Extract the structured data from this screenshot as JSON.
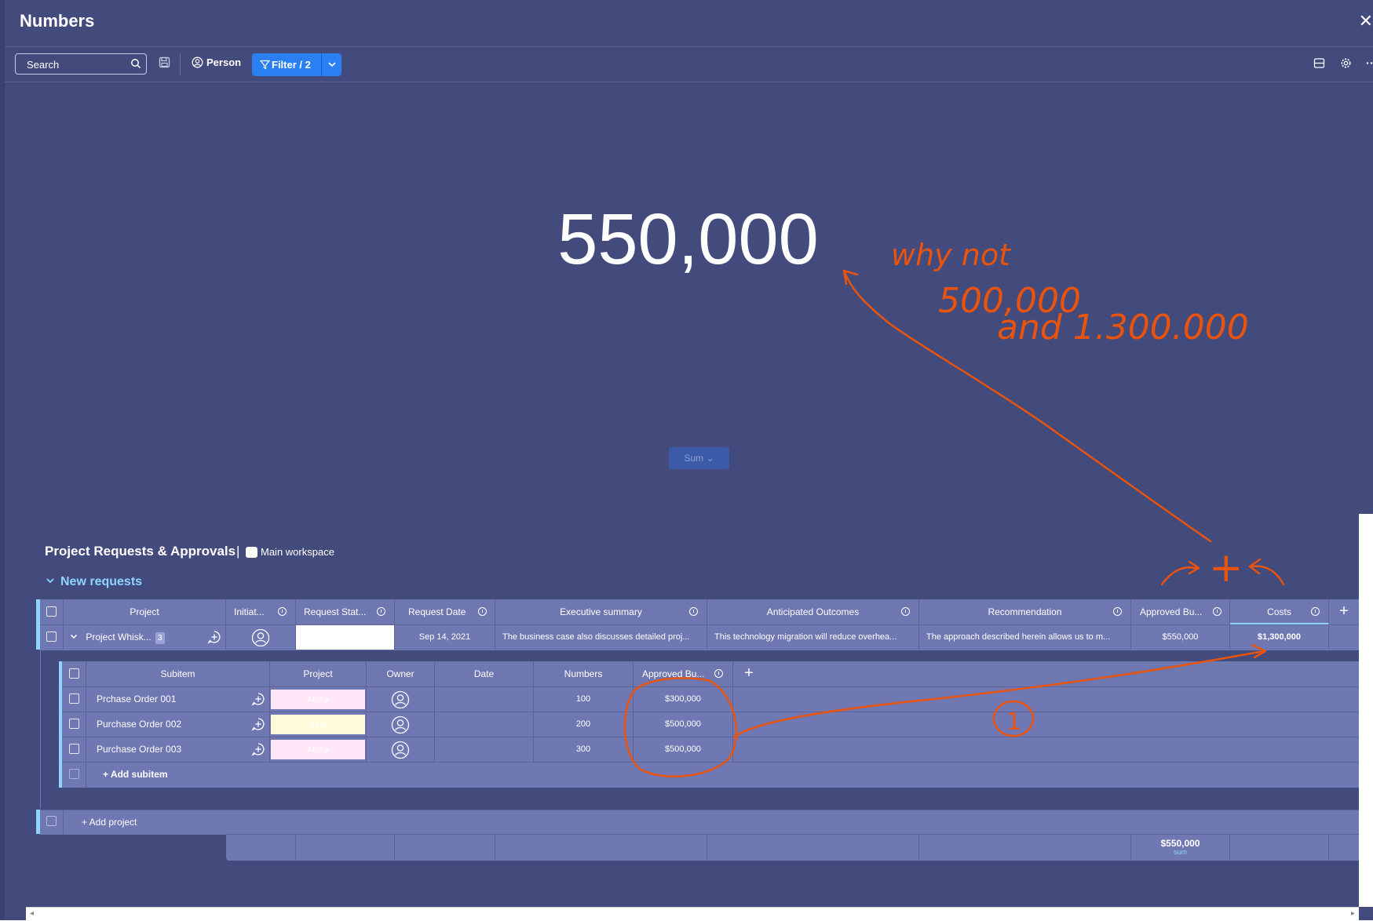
{
  "window": {
    "title": "Numbers",
    "close_glyph": "✕"
  },
  "toolbar": {
    "search_label": "Search",
    "person_label": "Person",
    "filter_label": "Filter / 2"
  },
  "widget": {
    "value": "550,000",
    "aggregate_label": "Sum ⌄"
  },
  "board": {
    "title": "Project Requests & Approvals",
    "separator": "|",
    "workspace": "Main workspace",
    "group_name": "New requests",
    "columns": [
      {
        "label": "Project"
      },
      {
        "label": "Initiat..."
      },
      {
        "label": "Request Stat..."
      },
      {
        "label": "Request Date"
      },
      {
        "label": "Executive summary"
      },
      {
        "label": "Anticipated Outcomes"
      },
      {
        "label": "Recommendation"
      },
      {
        "label": "Approved Bu..."
      },
      {
        "label": "Costs"
      }
    ],
    "item": {
      "name": "Project Whisk...",
      "subitem_count": "3",
      "request_date": "Sep 14, 2021",
      "executive_summary": "The business case also discusses detailed proj...",
      "anticipated_outcomes": "This technology migration will reduce overhea...",
      "recommendation": "The approach described herein allows us to m...",
      "approved_budget": "$550,000",
      "costs": "$1,300,000"
    },
    "sub_columns": [
      {
        "label": "Subitem"
      },
      {
        "label": "Project"
      },
      {
        "label": "Owner"
      },
      {
        "label": "Date"
      },
      {
        "label": "Numbers"
      },
      {
        "label": "Approved Bu..."
      }
    ],
    "subitems": [
      {
        "name": "Prchase Order 001",
        "project": "Alpha",
        "numbers": "100",
        "approved": "$300,000",
        "tag_color": "#ffe5f6"
      },
      {
        "name": "Purchase Order 002",
        "project": "Beta",
        "numbers": "200",
        "approved": "$500,000",
        "tag_color": "#fffbd9"
      },
      {
        "name": "Purchase Order 003",
        "project": "Alpha",
        "numbers": "300",
        "approved": "$500,000",
        "tag_color": "#ffe5f6"
      }
    ],
    "add_subitem": "+ Add subitem",
    "add_project": "+ Add project",
    "footer": {
      "approved_sum": "$550,000",
      "sum_label": "sum"
    }
  },
  "annotation": {
    "line1": "why not",
    "line2": "500,000",
    "line3": "and  1.300.000",
    "plus": "+",
    "marker": "1",
    "color": "#e8540e"
  }
}
